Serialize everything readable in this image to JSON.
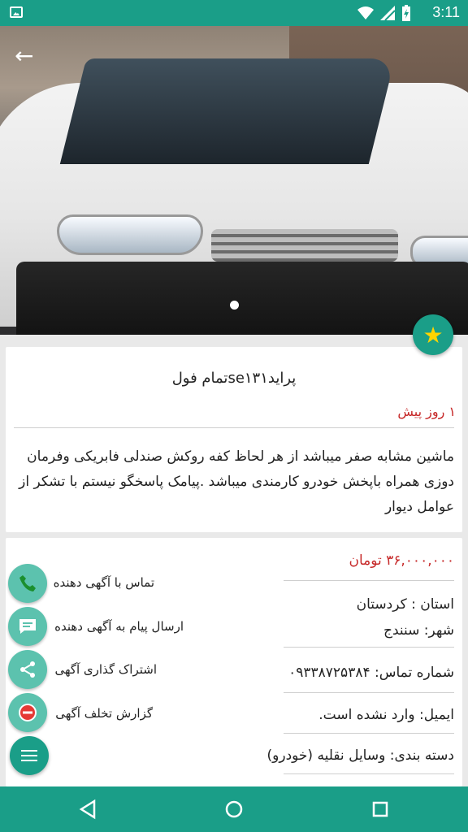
{
  "status_bar": {
    "time": "3:11",
    "icons": [
      "image-icon",
      "wifi-icon",
      "signal-icon",
      "battery-charging-icon"
    ]
  },
  "hero": {
    "image_description_icon": "car-photo",
    "page_indicator_count": 1,
    "back_icon": "back-arrow-icon"
  },
  "listing": {
    "title": "پرایدse۱۳۱تمام فول",
    "posted": "۱ روز پیش",
    "description": "ماشین مشابه صفر میباشد از هر لحاظ کفه روکش صندلی فابریکی وفرمان دوزی همراه باپخش خودرو کارمندی میباشد .پیامک پاسخگو نیستم با تشکر از عوامل دیوار"
  },
  "details": {
    "price": "۳۶,۰۰۰,۰۰۰  تومان",
    "province": "استان : کردستان",
    "city": "شهر: سنندج",
    "phone": "شماره تماس: ۰۹۳۳۸۷۲۵۳۸۴",
    "email": "ایمیل: وارد نشده است.",
    "category": "دسته بندی: وسایل نقلیه (خودرو)"
  },
  "actions": [
    {
      "label": "تماس با آگهی دهنده",
      "icon": "phone-icon"
    },
    {
      "label": "ارسال پیام به آگهی دهنده",
      "icon": "message-icon"
    },
    {
      "label": "اشتراک گذاری آگهی",
      "icon": "share-icon"
    },
    {
      "label": "گزارش تخلف آگهی",
      "icon": "report-icon"
    }
  ],
  "colors": {
    "primary": "#1a9e88",
    "action_bg": "#5cc2ae",
    "accent_red": "#c62828",
    "star": "#ffd400"
  }
}
